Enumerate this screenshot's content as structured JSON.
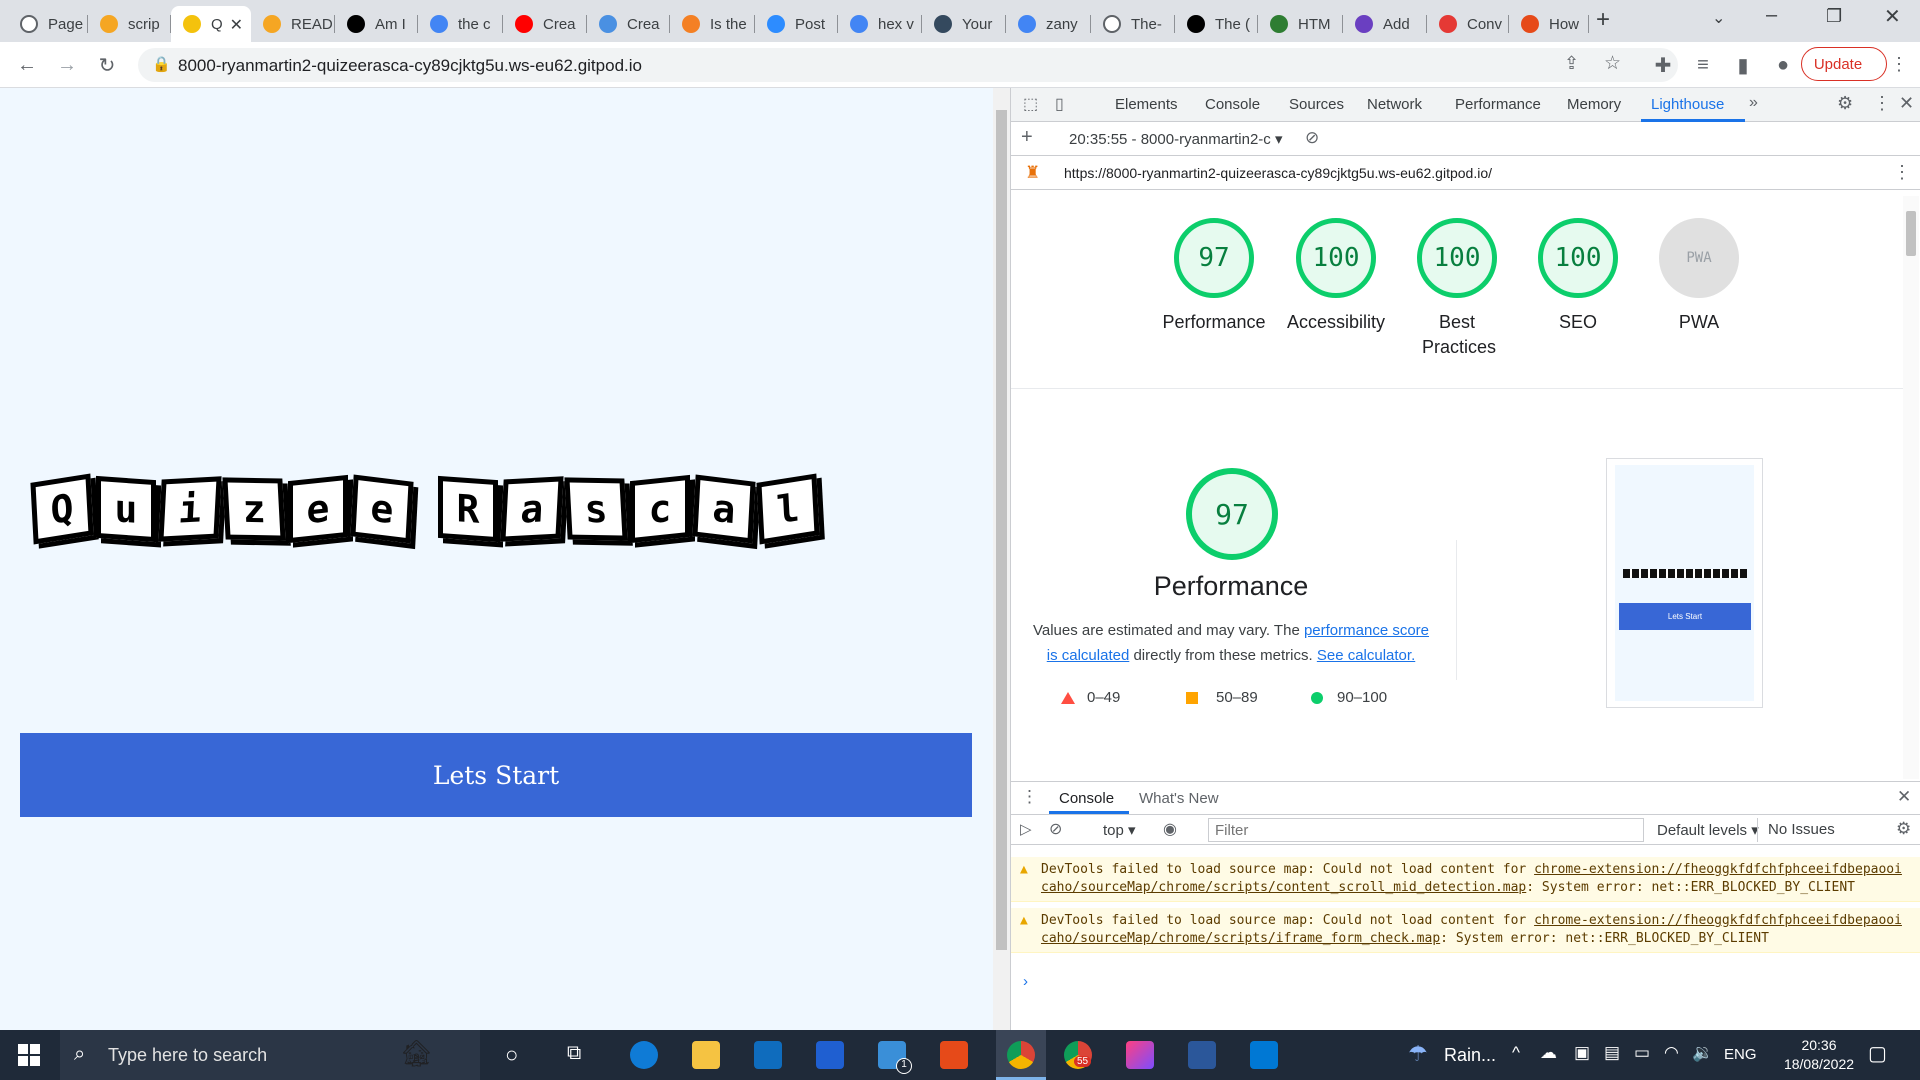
{
  "browser": {
    "tabs": [
      {
        "label": "Page",
        "color": "#ffffff"
      },
      {
        "label": "scrip",
        "color": "#f5a623"
      },
      {
        "label": "Q",
        "color": "#f4c20d"
      },
      {
        "label": "READ",
        "color": "#f5a623"
      },
      {
        "label": "Am I",
        "color": "#000000"
      },
      {
        "label": "the c",
        "color": "#4285f4"
      },
      {
        "label": "Crea",
        "color": "#ff0000"
      },
      {
        "label": "Crea",
        "color": "#4a90e2"
      },
      {
        "label": "Is the",
        "color": "#f48024"
      },
      {
        "label": "Post",
        "color": "#2d8cff"
      },
      {
        "label": "hex v",
        "color": "#4285f4"
      },
      {
        "label": "Your",
        "color": "#34495e"
      },
      {
        "label": "zany",
        "color": "#4285f4"
      },
      {
        "label": "The-",
        "color": "#ffffff"
      },
      {
        "label": "The (",
        "color": "#000000"
      },
      {
        "label": "HTM",
        "color": "#2e7d32"
      },
      {
        "label": "Add",
        "color": "#6a3fc1"
      },
      {
        "label": "Conv",
        "color": "#e53935"
      },
      {
        "label": "How",
        "color": "#e64a19"
      }
    ],
    "url": "8000-ryanmartin2-quizeerasca-cy89cjktg5u.ws-eu62.gitpod.io",
    "update_label": "Update"
  },
  "page": {
    "logo_letters": [
      "Q",
      "u",
      "i",
      "z",
      "e",
      "e",
      " ",
      "R",
      "a",
      "s",
      "c",
      "a",
      "l"
    ],
    "start_label": "Lets Start"
  },
  "devtools": {
    "tabs": [
      "Elements",
      "Console",
      "Sources",
      "Network",
      "Performance",
      "Memory",
      "Lighthouse"
    ],
    "active_tab": "Lighthouse",
    "report_select": "20:35:55 - 8000-ryanmartin2-c",
    "report_url": "https://8000-ryanmartin2-quizeerasca-cy89cjktg5u.ws-eu62.gitpod.io/",
    "scores": [
      {
        "value": "97",
        "label": "Performance"
      },
      {
        "value": "100",
        "label": "Accessibility"
      },
      {
        "value": "100",
        "label": "Best Practices"
      },
      {
        "value": "100",
        "label": "SEO"
      },
      {
        "value": "PWA",
        "label": "PWA"
      }
    ],
    "perf": {
      "score": "97",
      "title": "Performance",
      "desc_1": "Values are estimated and may vary. The ",
      "link_1": "performance score is calculated",
      "desc_2": " directly from these metrics. ",
      "link_2": "See calculator.",
      "legend": [
        {
          "range": "0–49",
          "color": "#ff4e42"
        },
        {
          "range": "50–89",
          "color": "#ffa400"
        },
        {
          "range": "90–100",
          "color": "#0cce6b"
        }
      ],
      "thumb_button": "Lets Start"
    },
    "drawer": {
      "tabs": [
        "Console",
        "What's New"
      ],
      "context": "top",
      "filter_placeholder": "Filter",
      "levels": "Default levels",
      "issues": "No Issues",
      "messages": [
        {
          "prefix": "DevTools failed to load source map: Could not load content for ",
          "link": "chrome-extension://fheoggkfdfchfphceeifdbepaooicaho/sourceMap/chrome/scripts/content_scroll_mid_detection.map",
          "suffix": ": System error: net::ERR_BLOCKED_BY_CLIENT"
        },
        {
          "prefix": "DevTools failed to load source map: Could not load content for ",
          "link": "chrome-extension://fheoggkfdfchfphceeifdbepaooicaho/sourceMap/chrome/scripts/iframe_form_check.map",
          "suffix": ": System error: net::ERR_BLOCKED_BY_CLIENT"
        }
      ]
    }
  },
  "taskbar": {
    "search_placeholder": "Type here to search",
    "weather": "Rain...",
    "lang": "ENG",
    "time": "20:36",
    "date": "18/08/2022",
    "chrome_badge": "55",
    "mail_badge": "1"
  }
}
